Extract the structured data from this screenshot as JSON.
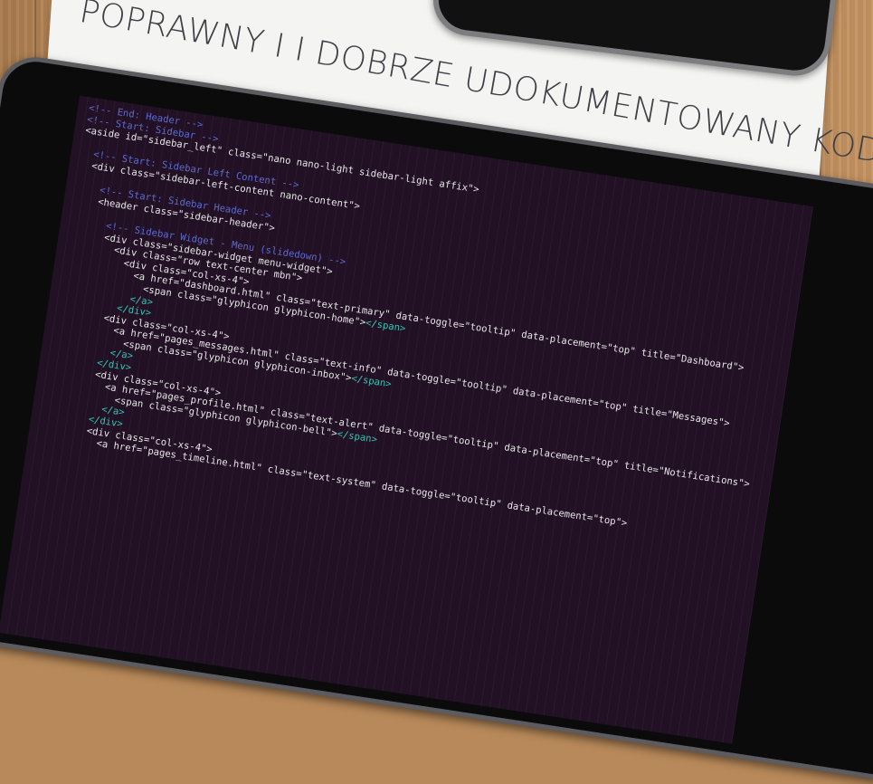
{
  "headline": "POPRAWNY I  I DOBRZE UDOKUMENTOWANY KOD",
  "colors": {
    "screen": "#221025",
    "comment": "#5d6bd0",
    "close_tag": "#31c4b0"
  },
  "code_lines": [
    "<!-- End: Header -->",
    "<!-- Start: Sidebar -->",
    "<aside id=\"sidebar_left\" class=\"nano nano-light sidebar-light affix\">",
    "",
    "  <!-- Start: Sidebar Left Content -->",
    "  <div class=\"sidebar-left-content nano-content\">",
    "",
    "    <!-- Start: Sidebar Header -->",
    "    <header class=\"sidebar-header\">",
    "",
    "      <!-- Sidebar Widget - Menu (slidedown) -->",
    "      <div class=\"sidebar-widget menu-widget\">",
    "        <div class=\"row text-center mbn\">",
    "          <div class=\"col-xs-4\">",
    "            <a href=\"dashboard.html\" class=\"text-primary\" data-toggle=\"tooltip\" data-placement=\"top\" title=\"Dashboard\">",
    "              <span class=\"glyphicon glyphicon-home\"></span>",
    "            </a>",
    "          </div>",
    "        <div class=\"col-xs-4\">",
    "          <a href=\"pages_messages.html\" class=\"text-info\" data-toggle=\"tooltip\" data-placement=\"top\" title=\"Messages\">",
    "            <span class=\"glyphicon glyphicon-inbox\"></span>",
    "          </a>",
    "        </div>",
    "        <div class=\"col-xs-4\">",
    "          <a href=\"pages_profile.html\" class=\"text-alert\" data-toggle=\"tooltip\" data-placement=\"top\" title=\"Notifications\">",
    "            <span class=\"glyphicon glyphicon-bell\"></span>",
    "          </a>",
    "        </div>",
    "        <div class=\"col-xs-4\">",
    "          <a href=\"pages_timeline.html\" class=\"text-system\" data-toggle=\"tooltip\" data-placement=\"top\">"
  ]
}
